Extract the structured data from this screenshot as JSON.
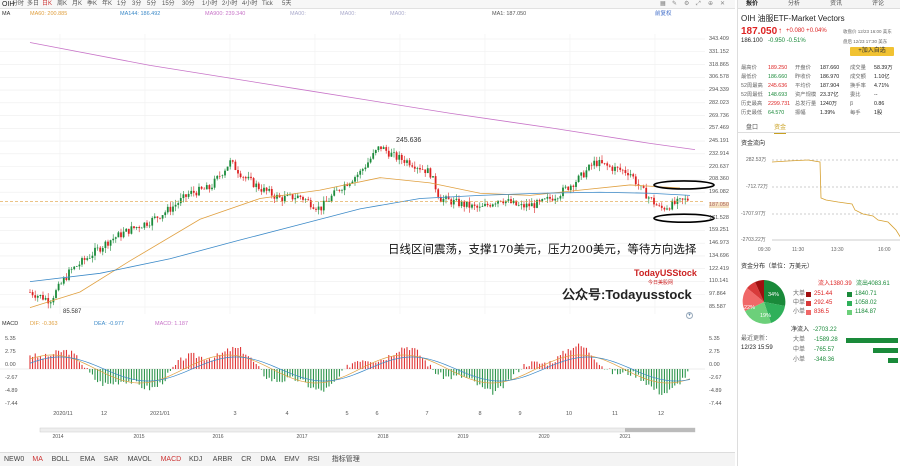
{
  "toolbar": {
    "symbol": "OIH",
    "tabs": [
      "分时",
      "多日",
      "日K",
      "周K",
      "月K",
      "季K",
      "年K",
      "1分",
      "3分",
      "5分",
      "15分",
      "30分",
      "1小时",
      "2小时",
      "4小时",
      "Tick",
      "5天"
    ],
    "active": "日K",
    "right_label": "前复权"
  },
  "legend": {
    "ma": "MA",
    "ma1": "MA60: 200.885",
    "ma2": "MA144: 186.492",
    "ma3": "MA900: 239.340",
    "ma4": "MA00:",
    "ma5": "MA00:",
    "ma6": "MA00:",
    "ma7": "MA1: 187.050"
  },
  "yaxis": [
    "343.409",
    "331.152",
    "318.865",
    "306.578",
    "294.339",
    "282.023",
    "269.736",
    "257.469",
    "245.191",
    "232.914",
    "220.637",
    "208.360",
    "196.082",
    "187.050",
    "171.528",
    "159.251",
    "146.973",
    "134.696",
    "122.419",
    "110.141",
    "97.864",
    "85.587"
  ],
  "annotations": {
    "high": "245.636",
    "low": "85.587",
    "note": "日线区间震荡，支撑170美元，压力200美元，等待方向选择",
    "brand1": "TodayUSStock",
    "brand2": "今日美股网",
    "brand3": "公众号:Todayusstock"
  },
  "macd": {
    "label": "MACD",
    "dif": "DIF: -0.363",
    "dea": "DEA: -0.977",
    "macd": "MACD: 1.187",
    "ticks": [
      "5.35",
      "2.75",
      "0.00",
      "-2.67",
      "-4.89",
      "-7.44"
    ],
    "rticks": [
      "5.35",
      "2.75",
      "0.00",
      "-2.67",
      "-4.89",
      "-7.44"
    ]
  },
  "xaxis": {
    "top": [
      "2020/11",
      "12",
      "2021/01",
      "3",
      "4",
      "5",
      "6",
      "7",
      "8",
      "9",
      "10",
      "11",
      "12"
    ],
    "bottom": [
      "2014",
      "2015",
      "2016",
      "2017",
      "2018",
      "2019",
      "2020",
      "2021"
    ]
  },
  "bottom": {
    "items": [
      "NEW0",
      "MA",
      "BOLL",
      "EMA",
      "SAR",
      "MAVOL",
      "MACD",
      "KDJ",
      "ARBR",
      "CR",
      "DMA",
      "EMV",
      "RSI",
      "指标管理"
    ],
    "selected": [
      "MA",
      "MACD"
    ]
  },
  "right": {
    "tabs": [
      "报价",
      "分析",
      "资讯",
      "评论"
    ],
    "name": "OIH 油服ETF-Market Vectors",
    "price": "187.050",
    "chg": "+0.080 +0.04%",
    "date1": "收盘价 12/23 16:00 美东",
    "price2": "186.100",
    "chg2": "-0.950 -0.51%",
    "date2": "盘后 12/23 17:30 美东",
    "add": "+加入自选",
    "stats": [
      [
        "最高价",
        "189.250",
        "开盘价",
        "187.660",
        "成交量",
        "58.39万"
      ],
      [
        "最低价",
        "186.660",
        "昨收价",
        "186.970",
        "成交额",
        "1.10亿"
      ],
      [
        "52周最高",
        "245.636",
        "平均价",
        "187.904",
        "换手率",
        "4.71%"
      ],
      [
        "52周最低",
        "148.693",
        "资产规模",
        "23.37亿",
        "委比",
        "--"
      ],
      [
        "历史最高",
        "2299.731",
        "总发行量",
        "1240万",
        "β",
        "0.86"
      ],
      [
        "历史最低",
        "64.570",
        "振幅",
        "1.39%",
        "每手",
        "1股"
      ]
    ],
    "tabs2": [
      "盘口",
      "资金"
    ],
    "flow_title": "资金流向",
    "flow_ticks": [
      "282.53万",
      "-712.72万",
      "-1707.97万",
      "-2703.22万"
    ],
    "flow_x": [
      "09:30",
      "11:30",
      "13:30",
      "16:00"
    ],
    "dist_title": "资金分布（单位：万美元）",
    "inflow": "流入",
    "inflow_v": "1380.39",
    "outflow": "流出",
    "outflow_v": "4083.61",
    "dist": [
      [
        "大单",
        "251.44",
        "1840.71"
      ],
      [
        "中单",
        "292.45",
        "1058.02"
      ],
      [
        "小单",
        "836.5",
        "1184.87"
      ]
    ],
    "pie": [
      "34%",
      "22%",
      "19%"
    ],
    "net": "净流入",
    "net_v": "-2703.22",
    "update": "最近更新：",
    "update_t": "12/23 15:59",
    "netrows": [
      [
        "大单",
        "-1589.28"
      ],
      [
        "中单",
        "-765.57"
      ],
      [
        "小单",
        "-348.36"
      ]
    ]
  },
  "colors": {
    "up": "#d22",
    "down": "#1a8a3a",
    "ma60": "#e0a040",
    "ma144": "#3c8ac8",
    "ma900": "#c874c8"
  }
}
